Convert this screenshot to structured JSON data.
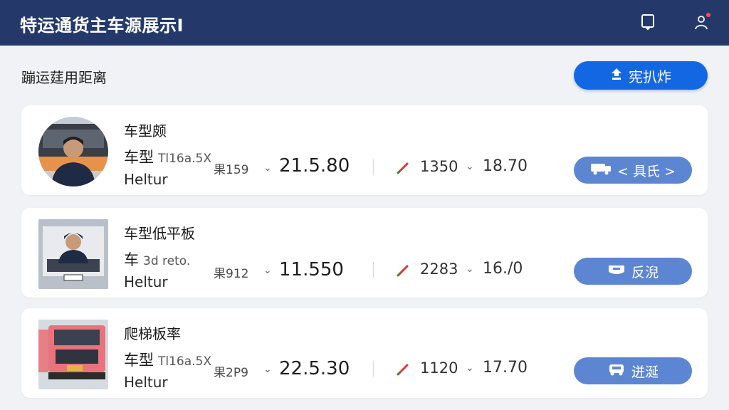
{
  "header": {
    "title": "特运通货主车源展示Ⅰ",
    "icons": [
      "bookmark-icon",
      "user-icon"
    ]
  },
  "subheader": {
    "title": "蹦运莛用距离",
    "primary_button": {
      "label": "宪扒炸",
      "icon": "upload-icon"
    }
  },
  "listings": [
    {
      "line1": "车型颇",
      "line2_main": "车型",
      "line2_small": "Tl16a.5X",
      "line3": "Heltur",
      "code": "果159",
      "big_value": "21.5.80",
      "mid_value": "1350",
      "right_value": "18.70",
      "button": {
        "label": "< 具氏 >",
        "icon": "truck-icon"
      }
    },
    {
      "line1": "车型低平板",
      "line2_main": "车",
      "line2_small": "3d reto.",
      "line3": "Heltur",
      "code": "果912",
      "big_value": "11.550",
      "mid_value": "2283",
      "right_value": "16./0",
      "button": {
        "label": "反淣",
        "icon": "cargo-icon"
      }
    },
    {
      "line1": "爬梯板率",
      "line2_main": "车型",
      "line2_small": "Tl16a.5X",
      "line3": "Heltur",
      "code": "果2P9",
      "big_value": "22.5.30",
      "mid_value": "1120",
      "right_value": "17.70",
      "button": {
        "label": "迸涎",
        "icon": "truck-icon"
      }
    }
  ],
  "colors": {
    "header_bg": "#24396a",
    "primary": "#1467e3",
    "card_button": "#5c86d2",
    "pen_accent": "#d93838"
  }
}
